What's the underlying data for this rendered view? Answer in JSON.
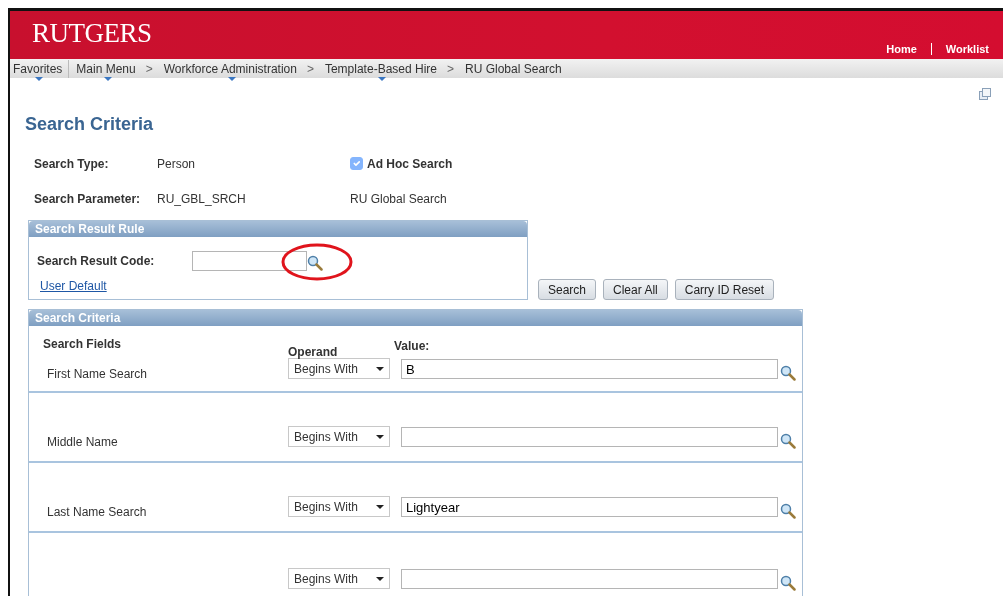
{
  "header": {
    "logo": "RUTGERS",
    "links": [
      "Home",
      "Worklist"
    ]
  },
  "breadcrumbs": [
    {
      "label": "Favorites",
      "has_menu": true
    },
    {
      "label": "Main Menu",
      "has_menu": true,
      "separator": ">"
    },
    {
      "label": "Workforce Administration",
      "has_menu": true,
      "separator": ">"
    },
    {
      "label": "Template-Based Hire",
      "has_menu": true,
      "separator": ">"
    },
    {
      "label": "RU Global Search",
      "has_menu": false
    }
  ],
  "title": "Search Criteria",
  "fields": [
    {
      "label": "Search Type:",
      "value": "Person"
    },
    {
      "label": "Search Parameter:",
      "value": "RU_GBL_SRCH"
    }
  ],
  "ad_hoc": {
    "label": "Ad Hoc Search",
    "checked": true,
    "disabled": true
  },
  "parameter_description": "RU Global Search",
  "result_rule": {
    "title": "Search Result Rule",
    "code_label": "Search Result Code:",
    "link": "User Default"
  },
  "buttons": [
    "Search",
    "Clear All",
    "Carry ID Reset"
  ],
  "criteria": {
    "title": "Search Criteria",
    "fields_heading": "Search Fields",
    "operand_heading": "Operand",
    "value_heading": "Value:",
    "rows": [
      {
        "label": "First Name Search",
        "operand": "Begins With",
        "value": "B"
      },
      {
        "label": "Middle Name",
        "operand": "Begins With"
      },
      {
        "label": "Last Name Search",
        "operand": "Begins With",
        "value": "Lightyear"
      },
      {
        "operand": "Begins With"
      }
    ]
  }
}
